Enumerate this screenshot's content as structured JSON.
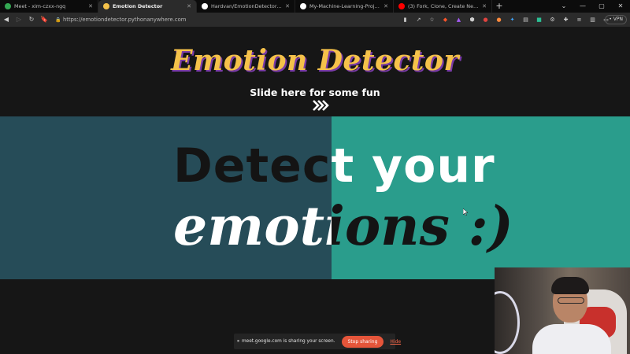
{
  "browser": {
    "tabs": [
      {
        "title": "Meet - xim-czxx-ngq",
        "active": false,
        "favicon_color": "#34a853"
      },
      {
        "title": "Emotion Detector",
        "active": true,
        "favicon_color": "#f5c24a"
      },
      {
        "title": "Hardvan/EmotionDetector: A web app",
        "active": false,
        "favicon_color": "#ffffff"
      },
      {
        "title": "My-Machine-Learning-Projects/Emoti",
        "active": false,
        "favicon_color": "#ffffff"
      },
      {
        "title": "(3) Fork, Clone, Create New Branch, Co",
        "active": false,
        "favicon_color": "#ff0000"
      }
    ],
    "url": "https://emotiondetector.pythonanywhere.com",
    "vpn_label": "• VPN"
  },
  "page": {
    "title": "Emotion Detector",
    "subtitle": "Slide here for some fun",
    "hero_line1": "Detect your",
    "hero_line2": "emotions :)",
    "colors": {
      "left_panel": "#264c58",
      "right_panel": "#2a9d8c",
      "title": "#f5c24a",
      "title_shadow": "#7a3ba8"
    }
  },
  "share_bar": {
    "message": "meet.google.com is sharing your screen.",
    "stop_label": "Stop sharing",
    "hide_label": "Hide"
  }
}
